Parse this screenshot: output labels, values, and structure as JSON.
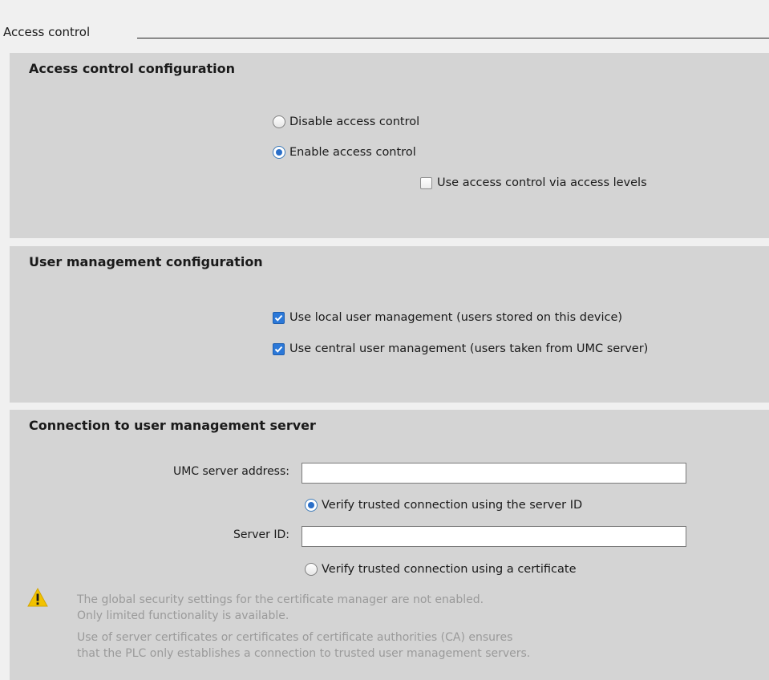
{
  "header": {
    "title": "Access control"
  },
  "access_config": {
    "title": "Access control configuration",
    "options": {
      "disable_label": "Disable access control",
      "enable_label": "Enable access control",
      "selected": "enable"
    },
    "access_levels_label": "Use access control via access levels",
    "access_levels_checked": false
  },
  "user_config": {
    "title": "User management configuration",
    "local_label": "Use local user management (users stored on this device)",
    "local_checked": true,
    "central_label": "Use central user management (users taken from UMC server)",
    "central_checked": true
  },
  "umc": {
    "title": "Connection to user management server",
    "server_address_label": "UMC server address:",
    "server_address_value": "",
    "verify_server_id_label": "Verify trusted connection using the server ID",
    "server_id_label": "Server ID:",
    "server_id_value": "",
    "verify_certificate_label": "Verify trusted connection using a certificate",
    "selected_verification": "server_id",
    "warning_icon": "warning-triangle-icon",
    "warning_lines": [
      "The global security settings for the certificate manager are not enabled.",
      "Only limited functionality is available.",
      "Use of server certificates or certificates of certificate authorities (CA) ensures",
      "that the PLC only establishes a connection to trusted user management servers."
    ]
  },
  "colors": {
    "section_bg": "#d4d4d4",
    "page_bg": "#f0f0f0",
    "accent": "#2b78d8",
    "warning_yellow": "#f2c200",
    "warning_text": "#9a9a9a"
  }
}
